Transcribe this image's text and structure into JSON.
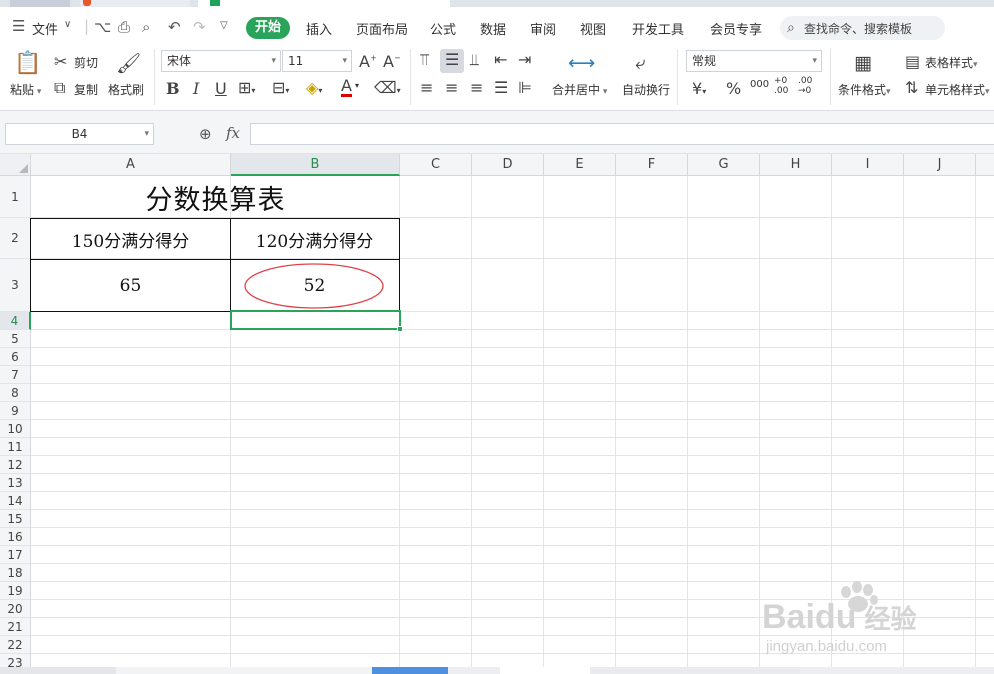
{
  "menu": {
    "file_label": "文件",
    "active_tab": "开始",
    "tabs": [
      "插入",
      "页面布局",
      "公式",
      "数据",
      "审阅",
      "视图",
      "开发工具",
      "会员专享"
    ],
    "search_placeholder": "查找命令、搜索模板"
  },
  "toolbar": {
    "paste": "粘贴",
    "cut": "剪切",
    "copy": "复制",
    "format_painter": "格式刷",
    "font_name": "宋体",
    "font_size": "11",
    "merge_center": "合并居中",
    "wrap_text": "自动换行",
    "number_format": "常规",
    "conditional_format": "条件格式",
    "table_style": "表格样式",
    "cell_style": "单元格样式",
    "bold": "B",
    "italic": "I",
    "underline": "U",
    "currency": "¥",
    "percent": "%",
    "thousands": "000",
    "inc_decimal": "+0 .00",
    "dec_decimal": ".00 →0"
  },
  "formula_bar": {
    "name_box": "B4",
    "fx": "fx",
    "value": ""
  },
  "grid": {
    "columns": [
      "A",
      "B",
      "C",
      "D",
      "E",
      "F",
      "G",
      "H",
      "I",
      "J"
    ],
    "active_column": "B",
    "active_row": "4",
    "rows": [
      "1",
      "2",
      "3",
      "4",
      "5",
      "6",
      "7",
      "8",
      "9",
      "10",
      "11",
      "12",
      "13",
      "14",
      "15",
      "16",
      "17",
      "18",
      "19",
      "20",
      "21",
      "22",
      "23"
    ],
    "cells": {
      "A1": "分数换算表",
      "A2": "150分满分得分",
      "B2": "120分满分得分",
      "A3": "65",
      "B3": "52"
    }
  },
  "watermark": {
    "brand": "Bai",
    "brand2": "du",
    "suffix": "经验",
    "url": "jingyan.baidu.com"
  },
  "colors": {
    "accent": "#2aa45a",
    "annotation": "#e0424a"
  }
}
